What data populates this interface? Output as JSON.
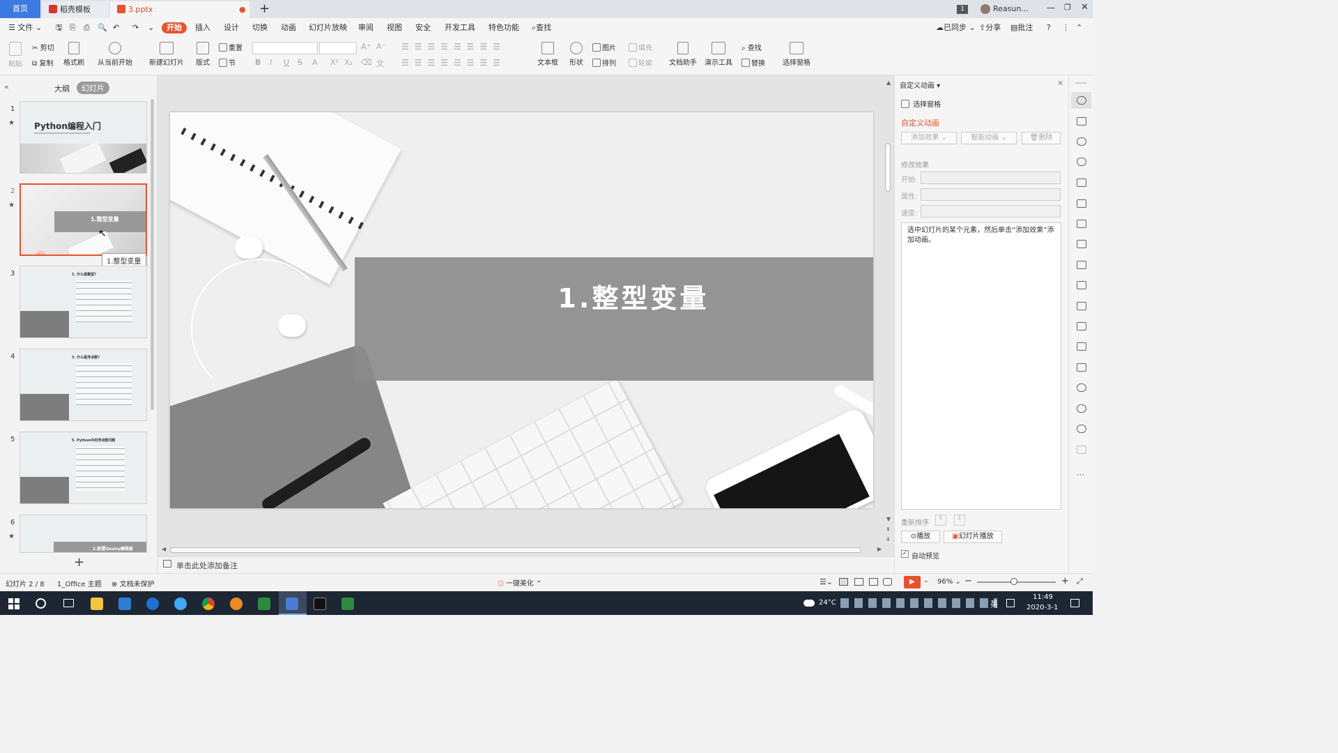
{
  "tabs": {
    "home": "首页",
    "template": "稻壳模板",
    "file": "3.pptx",
    "user": "Reasun...",
    "badge": "1"
  },
  "menu": {
    "file": "文件",
    "items": [
      "开始",
      "插入",
      "设计",
      "切换",
      "动画",
      "幻灯片放映",
      "审阅",
      "视图",
      "安全",
      "开发工具",
      "特色功能"
    ],
    "search": "查找",
    "sync": "已同步",
    "share": "分享",
    "comment": "批注"
  },
  "ribbon": {
    "paste": "粘贴",
    "cut": "剪切",
    "copy": "复制",
    "format_painter": "格式刷",
    "from_current": "从当前开始",
    "new_slide": "新建幻灯片",
    "layout": "版式",
    "section": "节",
    "reset": "重置",
    "textbox": "文本框",
    "shape": "形状",
    "picture": "图片",
    "fill": "填充",
    "arrange": "排列",
    "outline": "轮廓",
    "doc_helper": "文档助手",
    "presentation_tools": "演示工具",
    "find": "查找",
    "replace": "替换",
    "selection_pane": "选择窗格"
  },
  "left_panel": {
    "tab_outline": "大纲",
    "tab_slides": "幻灯片",
    "slides": [
      {
        "num": "1",
        "title": "Python编程入门"
      },
      {
        "num": "2",
        "title": "1.整型变量"
      },
      {
        "num": "3",
        "title": "1. 什么是整型?"
      },
      {
        "num": "4",
        "title": "3. 什么是浮点数?"
      },
      {
        "num": "5",
        "title": "5. Python中的浮点数问题"
      },
      {
        "num": "6",
        "title": "2.配置Geany编辑器"
      }
    ],
    "tooltip": "1.整型变量"
  },
  "slide": {
    "title": "1.整型变量"
  },
  "notes_placeholder": "单击此处添加备注",
  "right_panel": {
    "header": "自定义动画",
    "selection_pane": "选择窗格",
    "section_title": "自定义动画",
    "add_effect": "添加效果",
    "smart_animation": "智能动画",
    "delete": "删除",
    "modify_effect": "修改效果",
    "start_label": "开始:",
    "property_label": "属性:",
    "speed_label": "速度:",
    "hint": "选中幻灯片的某个元素，然后单击“添加效果”添加动画。",
    "reorder": "重新排序",
    "play": "播放",
    "slideshow": "幻灯片播放",
    "auto_preview": "自动预览"
  },
  "status": {
    "slide_count": "幻灯片 2 / 8",
    "theme": "1_Office 主题",
    "protection": "文档未保护",
    "beautify": "一键美化",
    "zoom": "96%"
  },
  "taskbar": {
    "temp": "24°C",
    "ime": "英",
    "time": "11:49",
    "date": "2020-3-1"
  }
}
